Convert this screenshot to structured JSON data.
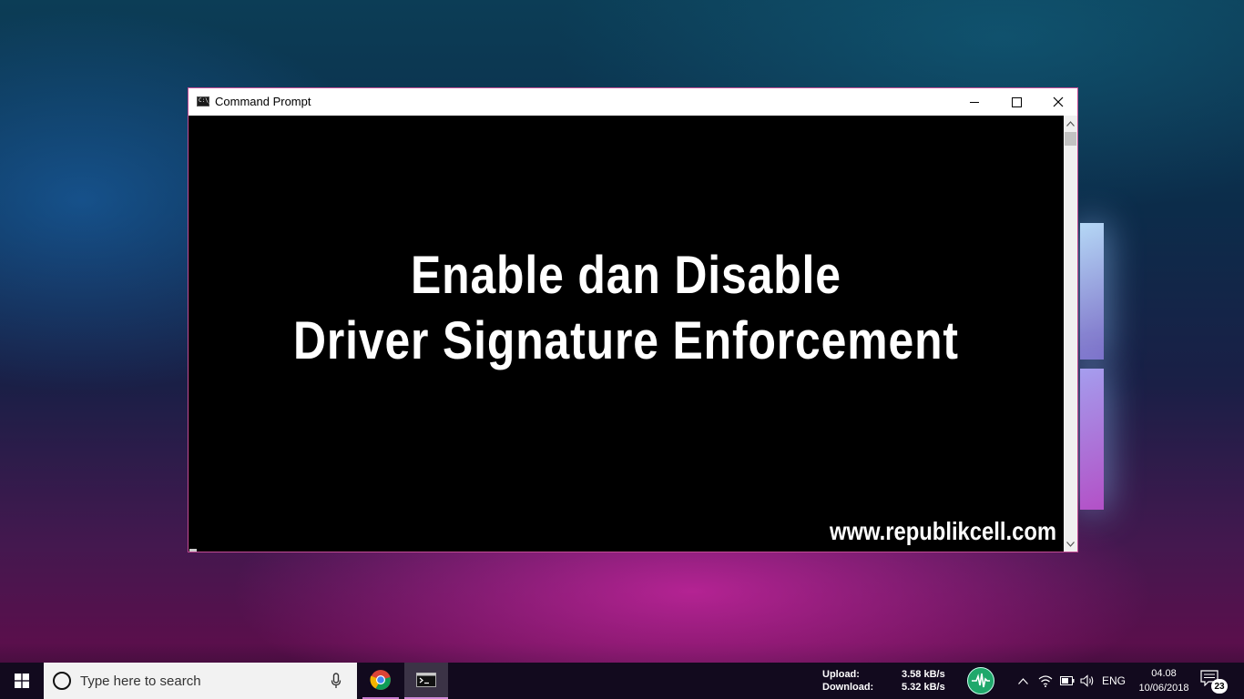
{
  "window": {
    "title": "Command Prompt",
    "icon": "cmd-icon",
    "icon_text": "C:\\_"
  },
  "console": {
    "headline_line1": "Enable dan Disable",
    "headline_line2": "Driver Signature Enforcement",
    "website": "www.republikcell.com"
  },
  "taskbar": {
    "search_placeholder": "Type here to search",
    "apps": [
      "chrome-icon",
      "cmd-icon"
    ],
    "netmeter": {
      "upload_label": "Upload:",
      "upload_value": "3.58 kB/s",
      "download_label": "Download:",
      "download_value": "5.32 kB/s"
    },
    "language": "ENG",
    "time": "04.08",
    "date": "10/06/2018",
    "notification_count": "23"
  },
  "colors": {
    "window_border": "#c34c95",
    "taskbar_bg": "#120a1e",
    "netmeter_icon": "#1fa86b"
  }
}
